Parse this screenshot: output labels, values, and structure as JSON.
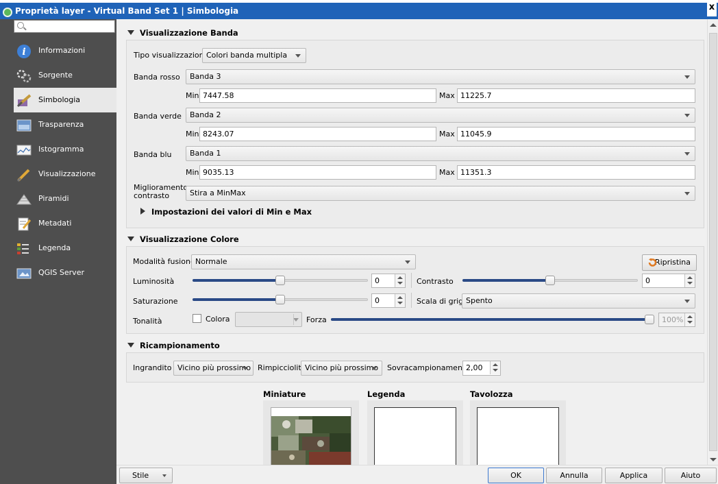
{
  "window": {
    "title": "Proprietà layer - Virtual Band Set 1 | Simbologia",
    "close_label": "x"
  },
  "search": {
    "placeholder": ""
  },
  "sidebar": {
    "items": [
      {
        "label": "Informazioni",
        "icon": "info-icon"
      },
      {
        "label": "Sorgente",
        "icon": "source-icon"
      },
      {
        "label": "Simbologia",
        "icon": "brush-icon",
        "active": true
      },
      {
        "label": "Trasparenza",
        "icon": "transparency-icon"
      },
      {
        "label": "Istogramma",
        "icon": "histogram-icon"
      },
      {
        "label": "Visualizzazione",
        "icon": "rendering-icon"
      },
      {
        "label": "Piramidi",
        "icon": "pyramids-icon"
      },
      {
        "label": "Metadati",
        "icon": "metadata-icon"
      },
      {
        "label": "Legenda",
        "icon": "legend-icon"
      },
      {
        "label": "QGIS Server",
        "icon": "server-icon"
      }
    ]
  },
  "band_rendering": {
    "title": "Visualizzazione Banda",
    "render_type_label": "Tipo visualizzazione",
    "render_type_value": "Colori banda multipla",
    "red_label": "Banda rosso",
    "red_value": "Banda 3",
    "red_min": "7447.58",
    "red_max": "11225.7",
    "green_label": "Banda verde",
    "green_value": "Banda 2",
    "green_min": "8243.07",
    "green_max": "11045.9",
    "blue_label": "Banda blu",
    "blue_value": "Banda 1",
    "blue_min": "9035.13",
    "blue_max": "11351.3",
    "min_label": "Min",
    "max_label": "Max",
    "contrast_label_1": "Miglioramento",
    "contrast_label_2": "contrasto",
    "contrast_value": "Stira a MinMax",
    "minmax_settings_label": "Impostazioni dei valori di Min e Max"
  },
  "color_rendering": {
    "title": "Visualizzazione Colore",
    "blend_label": "Modalità fusione",
    "blend_value": "Normale",
    "reset_label": "Ripristina",
    "brightness_label": "Luminosità",
    "brightness_value": "0",
    "contrast_label": "Contrasto",
    "contrast_value": "0",
    "saturation_label": "Saturazione",
    "saturation_value": "0",
    "grayscale_label": "Scala di grigi",
    "grayscale_value": "Spento",
    "hue_label": "Tonalità",
    "colorize_label": "Colora",
    "strength_label": "Forza",
    "strength_value": "100%"
  },
  "resampling": {
    "title": "Ricampionamento",
    "zoomed_in_label": "Ingrandito",
    "zoomed_in_value": "Vicino più prossimo",
    "zoomed_out_label": "Rimpicciolito",
    "zoomed_out_value": "Vicino più prossimo",
    "oversampling_label": "Sovracampionamento",
    "oversampling_value": "2,00"
  },
  "previews": {
    "thumbnail_label": "Miniature",
    "legend_label": "Legenda",
    "palette_label": "Tavolozza"
  },
  "footer": {
    "style_label": "Stile",
    "ok_label": "OK",
    "cancel_label": "Annulla",
    "apply_label": "Applica",
    "help_label": "Aiuto"
  },
  "colors": {
    "titlebar": "#1f63b8",
    "sidebar": "#4e4e4e",
    "slider_fill": "#2a4a86",
    "reset_icon": "#e07b24"
  }
}
